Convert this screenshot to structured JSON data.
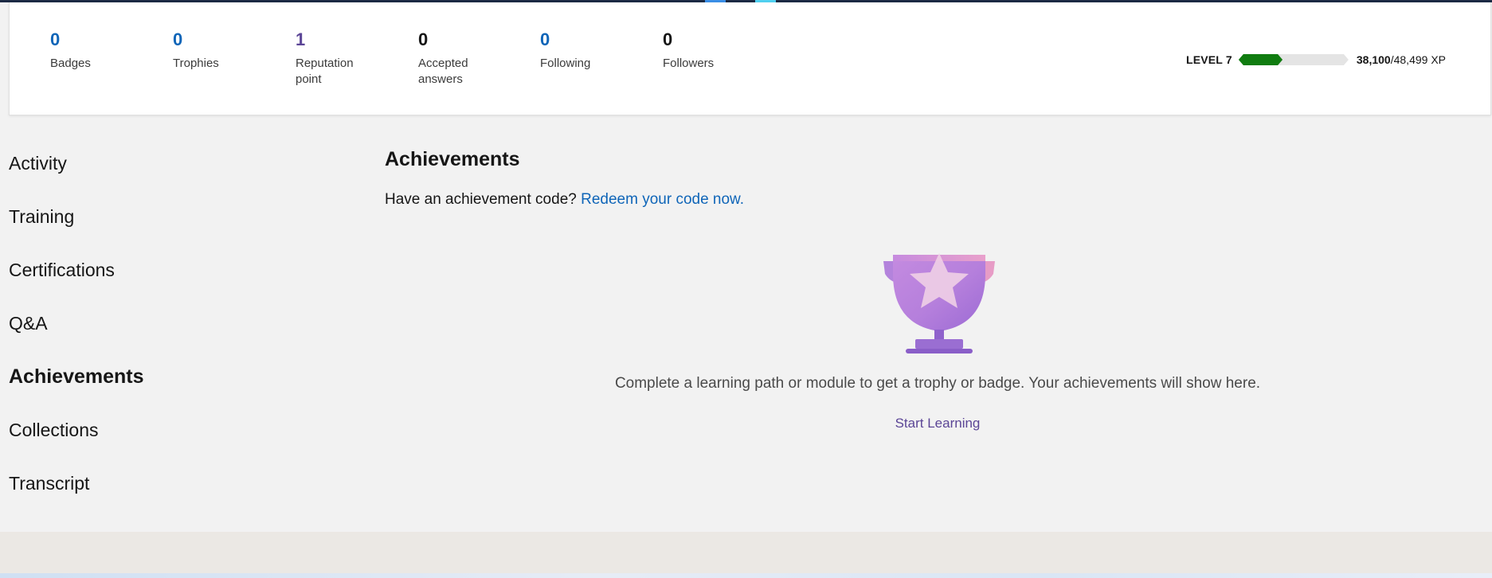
{
  "stats": [
    {
      "value": "0",
      "label": "Badges",
      "color": "#0f65b8"
    },
    {
      "value": "0",
      "label": "Trophies",
      "color": "#0f65b8"
    },
    {
      "value": "1",
      "label": "Reputation point",
      "color": "#5b4596"
    },
    {
      "value": "0",
      "label": "Accepted answers",
      "color": "#161616"
    },
    {
      "value": "0",
      "label": "Following",
      "color": "#0f65b8"
    },
    {
      "value": "0",
      "label": "Followers",
      "color": "#161616"
    }
  ],
  "level": {
    "label": "LEVEL 7",
    "xp_current": "38,100",
    "xp_total": "/48,499 XP",
    "progress_fraction": 0.4,
    "progress_color": "#107c10"
  },
  "sidebar": {
    "items": [
      {
        "label": "Activity",
        "active": false
      },
      {
        "label": "Training",
        "active": false
      },
      {
        "label": "Certifications",
        "active": false
      },
      {
        "label": "Q&A",
        "active": false
      },
      {
        "label": "Achievements",
        "active": true
      },
      {
        "label": "Collections",
        "active": false
      },
      {
        "label": "Transcript",
        "active": false
      }
    ]
  },
  "main": {
    "title": "Achievements",
    "code_prompt": "Have an achievement code?",
    "code_link": "Redeem your code now.",
    "empty_message": "Complete a learning path or module to get a trophy or badge. Your achievements will show here.",
    "start_link": "Start Learning",
    "trophy_icon": "trophy-icon"
  },
  "colors": {
    "link": "#0f65b8",
    "accent_purple": "#5b4596",
    "background": "#f2f2f2"
  }
}
